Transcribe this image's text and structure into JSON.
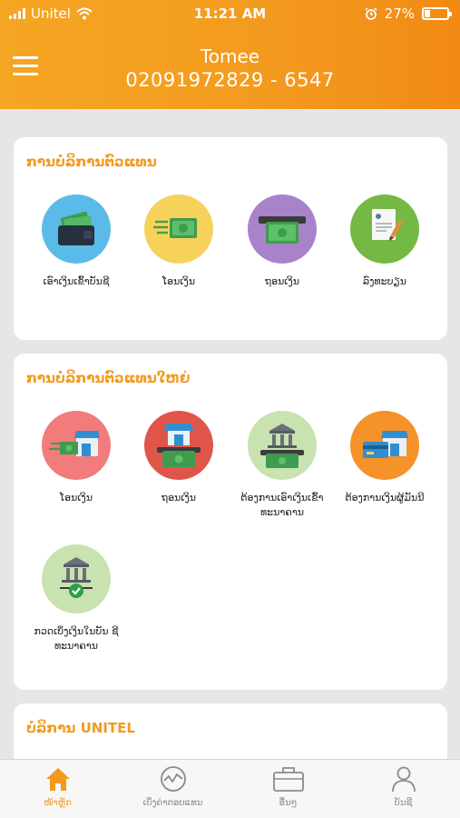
{
  "status_bar": {
    "carrier": "Unitel",
    "time": "11:21 AM",
    "battery_text": "27%",
    "battery_level": 0.27
  },
  "header": {
    "name": "Tomee",
    "phone": "02091972829 - 6547"
  },
  "cards": [
    {
      "title": "ການບໍລິການຕົວແທນ",
      "items": [
        {
          "label": "ເອົາເງິນເຂົ້າບັນຊີ",
          "icon": "wallet-cash-icon",
          "color": "#5bbbe8"
        },
        {
          "label": "ໂອນເງິນ",
          "icon": "transfer-money-icon",
          "color": "#f6d25b"
        },
        {
          "label": "ຖອນເງິນ",
          "icon": "withdraw-money-icon",
          "color": "#a883c9"
        },
        {
          "label": "ລົງທະບຽນ",
          "icon": "register-document-icon",
          "color": "#75b843"
        }
      ]
    },
    {
      "title": "ການບໍລິການຕົວແທນໃຫຍ່",
      "items": [
        {
          "label": "ໂອນເງິນ",
          "icon": "shop-transfer-icon",
          "color": "#f27b7b"
        },
        {
          "label": "ຖອນເງິນ",
          "icon": "shop-withdraw-icon",
          "color": "#e0554a"
        },
        {
          "label": "ຕ້ອງການເອົາເງິນເຂົ້າ ທະນາຄານ",
          "icon": "bank-deposit-icon",
          "color": "#c9e3b0"
        },
        {
          "label": "ຕ້ອງການເງິນຜູ້ມັນນີ",
          "icon": "shop-card-icon",
          "color": "#f5922a"
        },
        {
          "label": "ກວດເບິ່ງເງິນໃນບັນ ຊີທະນາຄານ",
          "icon": "bank-check-icon",
          "color": "#c9e3b0"
        }
      ]
    },
    {
      "title": "ບໍລິການ UNITEL"
    }
  ],
  "tabbar": {
    "tabs": [
      {
        "label": "ໜ້າຫຼັກ",
        "icon": "home-icon",
        "active": true
      },
      {
        "label": "ເບິ່ງຄ່າຕອບແທນ",
        "icon": "chart-icon",
        "active": false
      },
      {
        "label": "ອື່ນໆ",
        "icon": "briefcase-icon",
        "active": false
      },
      {
        "label": "ບັນຊີ",
        "icon": "user-icon",
        "active": false
      }
    ]
  },
  "colors": {
    "brand": "#f39a1e",
    "inactive_tab": "#8a8a8a"
  }
}
